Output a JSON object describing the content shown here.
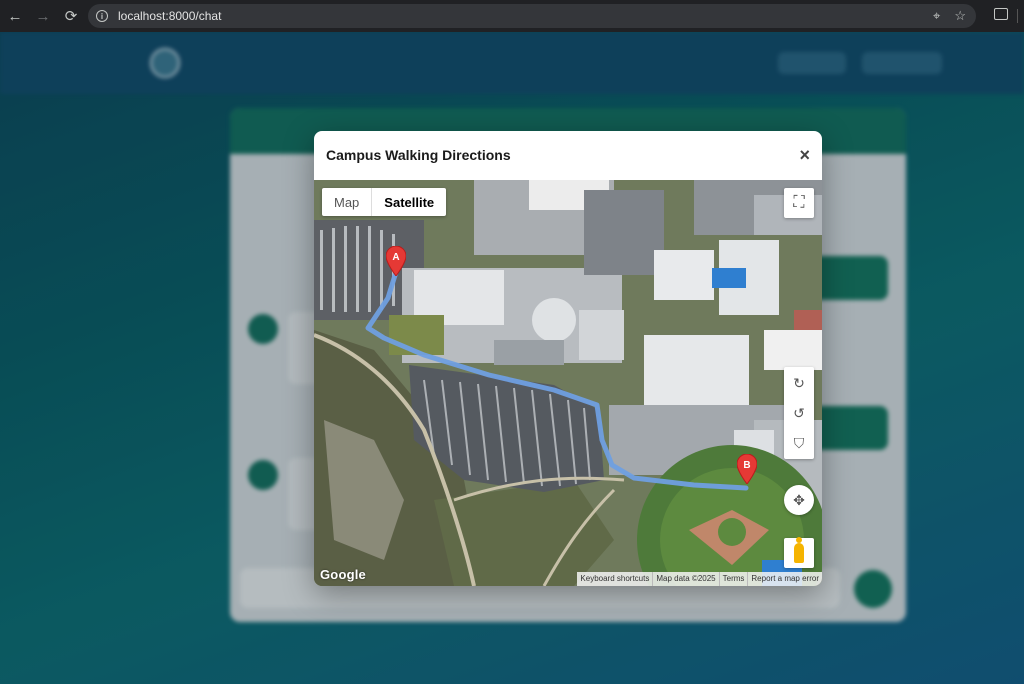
{
  "browser": {
    "url": "localhost:8000/chat",
    "back_icon": "back-arrow-icon",
    "forward_icon": "forward-arrow-icon",
    "reload_icon": "reload-icon"
  },
  "modal": {
    "title": "Campus Walking Directions",
    "close_label": "×"
  },
  "map": {
    "type_options": [
      "Map",
      "Satellite"
    ],
    "selected_type": "Satellite",
    "marker_a": "A",
    "marker_b": "B",
    "google_logo": "Google",
    "attribution": {
      "shortcuts": "Keyboard shortcuts",
      "data": "Map data ©2025",
      "terms": "Terms",
      "report": "Report a map error"
    },
    "route_color": "#6f9fe0",
    "marker_color": "#e53935"
  }
}
